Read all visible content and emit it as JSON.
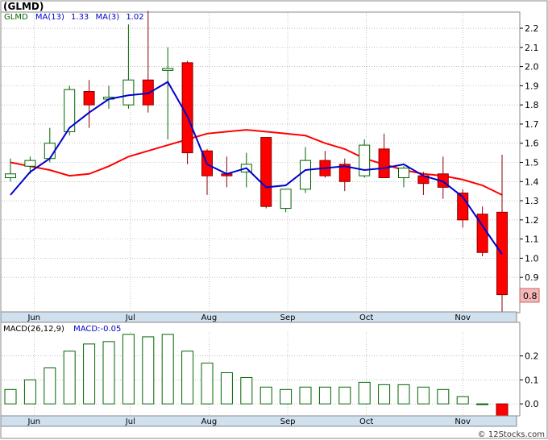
{
  "header": {
    "symbol": "(GLMD)",
    "ticker_label": "GLMD",
    "ma13_label": "MA(13)",
    "ma13_value": "1.33",
    "ma3_label": "MA(3)",
    "ma3_value": "1.02",
    "macd_label": "MACD(26,12,9)",
    "macd_value_label": "MACD:-0.05"
  },
  "footer": {
    "watermark": "© 12Stocks.com"
  },
  "colors": {
    "up_candle_fill": "#ffffff",
    "up_candle_stroke": "#006400",
    "down_candle_fill": "#ff0000",
    "down_candle_stroke": "#8b0000",
    "ma13_line": "#ff0000",
    "ma3_line": "#0000cc",
    "axis_band": "#cfe0ef",
    "grid": "#999999",
    "last_price_box": "#f4b8b8",
    "macd_bar_stroke": "#006400"
  },
  "chart_data": [
    {
      "type": "candlestick",
      "title": "(GLMD)",
      "ylim": [
        0.72,
        2.28
      ],
      "yticks": [
        "2.2",
        "2.1",
        "2.0",
        "1.9",
        "1.8",
        "1.7",
        "1.6",
        "1.5",
        "1.4",
        "1.3",
        "1.2",
        "1.1",
        "1.0",
        "0.9"
      ],
      "ytick_values": [
        2.2,
        2.1,
        2.0,
        1.9,
        1.8,
        1.7,
        1.6,
        1.5,
        1.4,
        1.3,
        1.2,
        1.1,
        1.0,
        0.9
      ],
      "x_labels": [
        "Jun",
        "Jul",
        "Aug",
        "Sep",
        "Oct",
        "Nov"
      ],
      "x_label_at_index": [
        1.2,
        6.1,
        10.1,
        14.1,
        18.1,
        23.0
      ],
      "last_price": "0.8",
      "last_price_value": 0.8,
      "candles": [
        {
          "o": 1.42,
          "h": 1.52,
          "l": 1.4,
          "c": 1.44
        },
        {
          "o": 1.48,
          "h": 1.53,
          "l": 1.44,
          "c": 1.51
        },
        {
          "o": 1.52,
          "h": 1.68,
          "l": 1.5,
          "c": 1.6
        },
        {
          "o": 1.66,
          "h": 1.9,
          "l": 1.64,
          "c": 1.88
        },
        {
          "o": 1.87,
          "h": 1.93,
          "l": 1.68,
          "c": 1.8
        },
        {
          "o": 1.83,
          "h": 1.9,
          "l": 1.78,
          "c": 1.84
        },
        {
          "o": 1.8,
          "h": 2.22,
          "l": 1.78,
          "c": 1.93
        },
        {
          "o": 1.93,
          "h": 2.29,
          "l": 1.76,
          "c": 1.8
        },
        {
          "o": 1.98,
          "h": 2.1,
          "l": 1.62,
          "c": 1.99
        },
        {
          "o": 2.02,
          "h": 2.03,
          "l": 1.49,
          "c": 1.55
        },
        {
          "o": 1.56,
          "h": 1.57,
          "l": 1.33,
          "c": 1.43
        },
        {
          "o": 1.44,
          "h": 1.53,
          "l": 1.37,
          "c": 1.43
        },
        {
          "o": 1.45,
          "h": 1.55,
          "l": 1.37,
          "c": 1.49
        },
        {
          "o": 1.63,
          "h": 1.63,
          "l": 1.26,
          "c": 1.27
        },
        {
          "o": 1.26,
          "h": 1.36,
          "l": 1.24,
          "c": 1.36
        },
        {
          "o": 1.36,
          "h": 1.58,
          "l": 1.34,
          "c": 1.51
        },
        {
          "o": 1.51,
          "h": 1.56,
          "l": 1.42,
          "c": 1.43
        },
        {
          "o": 1.49,
          "h": 1.52,
          "l": 1.35,
          "c": 1.4
        },
        {
          "o": 1.43,
          "h": 1.62,
          "l": 1.42,
          "c": 1.59
        },
        {
          "o": 1.57,
          "h": 1.65,
          "l": 1.42,
          "c": 1.42
        },
        {
          "o": 1.42,
          "h": 1.48,
          "l": 1.37,
          "c": 1.47
        },
        {
          "o": 1.43,
          "h": 1.45,
          "l": 1.33,
          "c": 1.39
        },
        {
          "o": 1.44,
          "h": 1.53,
          "l": 1.31,
          "c": 1.37
        },
        {
          "o": 1.34,
          "h": 1.36,
          "l": 1.16,
          "c": 1.2
        },
        {
          "o": 1.23,
          "h": 1.27,
          "l": 1.01,
          "c": 1.03
        },
        {
          "o": 1.24,
          "h": 1.54,
          "l": 0.7,
          "c": 0.81
        }
      ],
      "series": [
        {
          "name": "MA(13)",
          "values": [
            1.5,
            1.47,
            1.46,
            1.43,
            1.44,
            null,
            null,
            null,
            null,
            1.66,
            1.68,
            1.66,
            1.67,
            1.66,
            1.65,
            1.64,
            1.59,
            1.56,
            1.52,
            1.48,
            1.49,
            1.44,
            1.43,
            1.41,
            1.38,
            1.33
          ]
        },
        {
          "name": "MA(3)",
          "values": [
            1.34,
            1.45,
            1.52,
            1.68,
            1.76,
            1.83,
            1.85,
            1.86,
            1.92,
            null,
            null,
            null,
            null,
            null,
            null,
            null,
            null,
            null,
            null,
            1.47,
            1.48,
            null,
            null,
            null,
            null,
            1.02
          ]
        }
      ],
      "ma13_path": [
        [
          0,
          1.5
        ],
        [
          1,
          1.48
        ],
        [
          2,
          1.46
        ],
        [
          3,
          1.43
        ],
        [
          4,
          1.44
        ],
        [
          5,
          1.48
        ],
        [
          6,
          1.53
        ],
        [
          7,
          1.56
        ],
        [
          8,
          1.59
        ],
        [
          9,
          1.62
        ],
        [
          10,
          1.65
        ],
        [
          11,
          1.66
        ],
        [
          12,
          1.67
        ],
        [
          13,
          1.66
        ],
        [
          14,
          1.65
        ],
        [
          15,
          1.64
        ],
        [
          16,
          1.6
        ],
        [
          17,
          1.57
        ],
        [
          18,
          1.52
        ],
        [
          19,
          1.49
        ],
        [
          20,
          1.46
        ],
        [
          21,
          1.44
        ],
        [
          22,
          1.43
        ],
        [
          23,
          1.41
        ],
        [
          24,
          1.38
        ],
        [
          25,
          1.33
        ]
      ],
      "ma3_path": [
        [
          0,
          1.33
        ],
        [
          1,
          1.45
        ],
        [
          2,
          1.52
        ],
        [
          3,
          1.68
        ],
        [
          4,
          1.76
        ],
        [
          5,
          1.83
        ],
        [
          6,
          1.85
        ],
        [
          7,
          1.86
        ],
        [
          8,
          1.92
        ],
        [
          9,
          1.74
        ],
        [
          10,
          1.49
        ],
        [
          11,
          1.44
        ],
        [
          12,
          1.47
        ],
        [
          13,
          1.37
        ],
        [
          14,
          1.38
        ],
        [
          15,
          1.46
        ],
        [
          16,
          1.47
        ],
        [
          17,
          1.48
        ],
        [
          18,
          1.46
        ],
        [
          19,
          1.47
        ],
        [
          20,
          1.49
        ],
        [
          21,
          1.43
        ],
        [
          22,
          1.4
        ],
        [
          23,
          1.32
        ],
        [
          24,
          1.17
        ],
        [
          25,
          1.02
        ]
      ]
    },
    {
      "type": "bar",
      "title": "MACD(26,12,9)",
      "ylim": [
        -0.05,
        0.3
      ],
      "yticks": [
        "0.2",
        "0.1",
        "0.0"
      ],
      "ytick_values": [
        0.2,
        0.1,
        0.0
      ],
      "x_labels": [
        "Jun",
        "Jul",
        "Aug",
        "Sep",
        "Oct",
        "Nov"
      ],
      "x_label_at_index": [
        1.2,
        6.1,
        10.1,
        14.1,
        18.1,
        23.0
      ],
      "values": [
        0.06,
        0.1,
        0.15,
        0.22,
        0.25,
        0.26,
        0.29,
        0.28,
        0.29,
        0.22,
        0.17,
        0.13,
        0.11,
        0.07,
        0.06,
        0.07,
        0.07,
        0.07,
        0.09,
        0.08,
        0.08,
        0.07,
        0.06,
        0.03,
        -0.0,
        -0.05
      ]
    }
  ]
}
